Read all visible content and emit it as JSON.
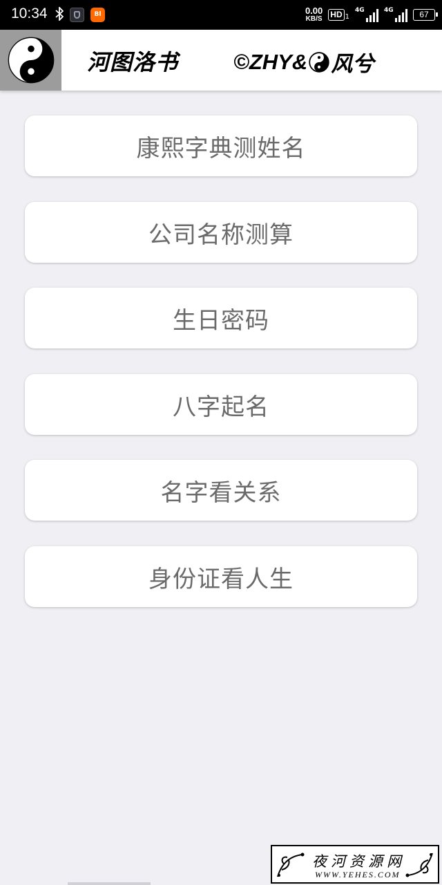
{
  "status_bar": {
    "time": "10:34",
    "net_speed": "0.00",
    "net_unit": "KB/S",
    "hd_label": "HD",
    "hd_sub": "1",
    "sim1_label": "4G",
    "sim2_label": "4G",
    "battery": "67",
    "app2_badge": "Bl"
  },
  "header": {
    "title": "河图洛书",
    "copyright_prefix": "©ZHY&",
    "copyright_suffix": "风兮"
  },
  "menu": {
    "items": [
      {
        "label": "康熙字典测姓名"
      },
      {
        "label": "公司名称测算"
      },
      {
        "label": "生日密码"
      },
      {
        "label": "八字起名"
      },
      {
        "label": "名字看关系"
      },
      {
        "label": "身份证看人生"
      }
    ]
  },
  "watermark": {
    "text": "夜河资源网",
    "url": "WWW.YEHES.COM"
  }
}
